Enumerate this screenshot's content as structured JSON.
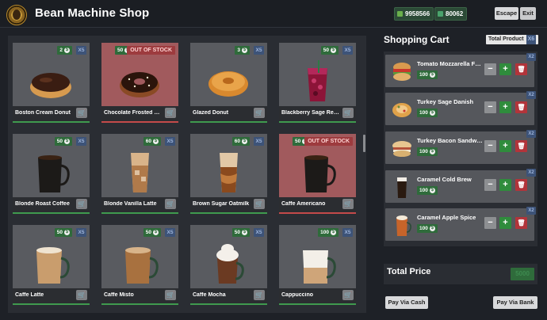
{
  "app": {
    "title": "Bean Machine Shop",
    "currency_1": "9958566",
    "currency_2": "80062",
    "escape_label": "Escape",
    "exit_label": "Exit"
  },
  "products": [
    {
      "name": "Boston Cream Donut",
      "price": "2",
      "qty": "X5",
      "out_of_stock": false,
      "icon": "donut-cream-icon"
    },
    {
      "name": "Chocolate Frosted Donut",
      "price": "50",
      "qty": "",
      "out_of_stock": true,
      "oos_label": "OUT OF STOCK",
      "icon": "donut-chocolate-icon"
    },
    {
      "name": "Glazed Donut",
      "price": "3",
      "qty": "X5",
      "out_of_stock": false,
      "icon": "donut-glazed-icon"
    },
    {
      "name": "Blackberry Sage Refresher",
      "price": "50",
      "qty": "X5",
      "out_of_stock": false,
      "icon": "berry-drink-icon"
    },
    {
      "name": "Blonde Roast Coffee",
      "price": "50",
      "qty": "X5",
      "out_of_stock": false,
      "icon": "dark-coffee-icon"
    },
    {
      "name": "Blonde Vanilla Latte",
      "price": "60",
      "qty": "X5",
      "out_of_stock": false,
      "icon": "iced-latte-icon"
    },
    {
      "name": "Brown Sugar Oatmilk",
      "price": "60",
      "qty": "X5",
      "out_of_stock": false,
      "icon": "iced-shaken-icon"
    },
    {
      "name": "Caffe Americano",
      "price": "50",
      "qty": "",
      "out_of_stock": true,
      "oos_label": "OUT OF STOCK",
      "icon": "dark-coffee-icon"
    },
    {
      "name": "Caffe Latte",
      "price": "50",
      "qty": "X5",
      "out_of_stock": false,
      "icon": "latte-mug-icon"
    },
    {
      "name": "Caffe Misto",
      "price": "50",
      "qty": "X5",
      "out_of_stock": false,
      "icon": "misto-mug-icon"
    },
    {
      "name": "Caffe Mocha",
      "price": "50",
      "qty": "X5",
      "out_of_stock": false,
      "icon": "mocha-mug-icon"
    },
    {
      "name": "Cappuccino",
      "price": "100",
      "qty": "X5",
      "out_of_stock": false,
      "icon": "cappuccino-mug-icon"
    }
  ],
  "cart": {
    "title": "Shopping Cart",
    "total_product_label": "Total Product",
    "total_product_count": "X6",
    "items": [
      {
        "name": "Tomato Mozzarella Focaccia",
        "price": "100",
        "qty": "X2",
        "icon": "sandwich-icon"
      },
      {
        "name": "Turkey Sage Danish",
        "price": "100",
        "qty": "X2",
        "icon": "danish-icon"
      },
      {
        "name": "Turkey Bacon Sandwich",
        "price": "100",
        "qty": "X2",
        "icon": "sandwich-icon"
      },
      {
        "name": "Caramel Cold Brew",
        "price": "100",
        "qty": "X2",
        "icon": "cold-brew-icon"
      },
      {
        "name": "Caramel Apple Spice",
        "price": "100",
        "qty": "X2",
        "icon": "apple-spice-icon"
      }
    ],
    "minus_label": "−",
    "plus_label": "+",
    "total_label": "Total Price",
    "total_value": "5000",
    "pay_cash_label": "Pay Via Cash",
    "pay_bank_label": "Pay Via Bank"
  },
  "colors": {
    "accent_green": "#2f8c3c",
    "danger_red": "#b2343a",
    "qty_blue": "#3d5378"
  }
}
